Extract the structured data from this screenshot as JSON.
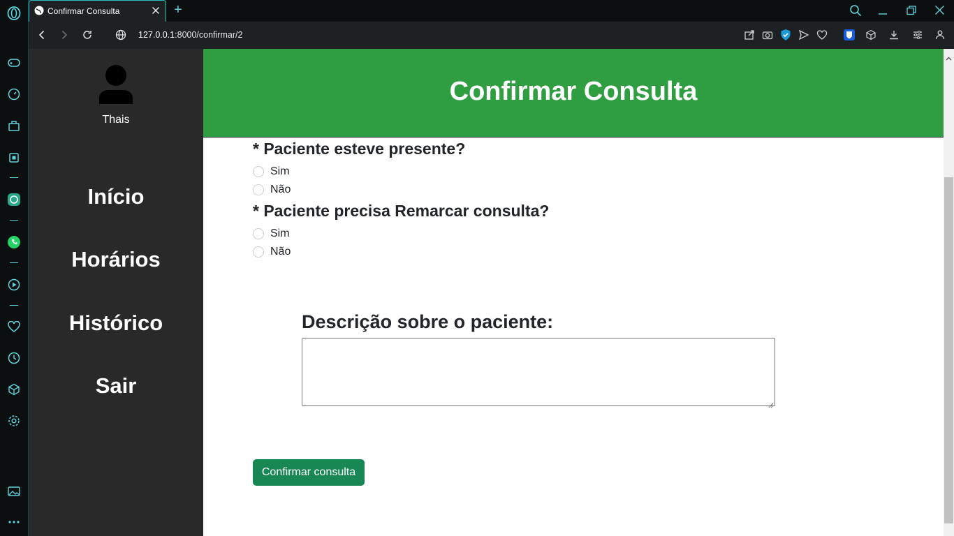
{
  "browser": {
    "tab_title": "Confirmar Consulta",
    "url_host": "127.0.0.1",
    "url_path": ":8000/confirmar/2",
    "accent_color": "#2bbdc6"
  },
  "sidebar": {
    "username": "Thais",
    "nav": [
      {
        "label": "Início"
      },
      {
        "label": "Horários"
      },
      {
        "label": "Histórico"
      },
      {
        "label": "Sair"
      }
    ]
  },
  "header": {
    "title": "Confirmar Consulta",
    "color": "#2e9e41"
  },
  "form": {
    "q1": {
      "label": "* Paciente esteve presente?",
      "options": [
        "Sim",
        "Não"
      ]
    },
    "q2": {
      "label": "* Paciente precisa Remarcar consulta?",
      "options": [
        "Sim",
        "Não"
      ]
    },
    "description_label": "Descrição sobre o paciente:",
    "description_value": "",
    "submit_label": "Confirmar consulta",
    "submit_color": "#198754"
  }
}
